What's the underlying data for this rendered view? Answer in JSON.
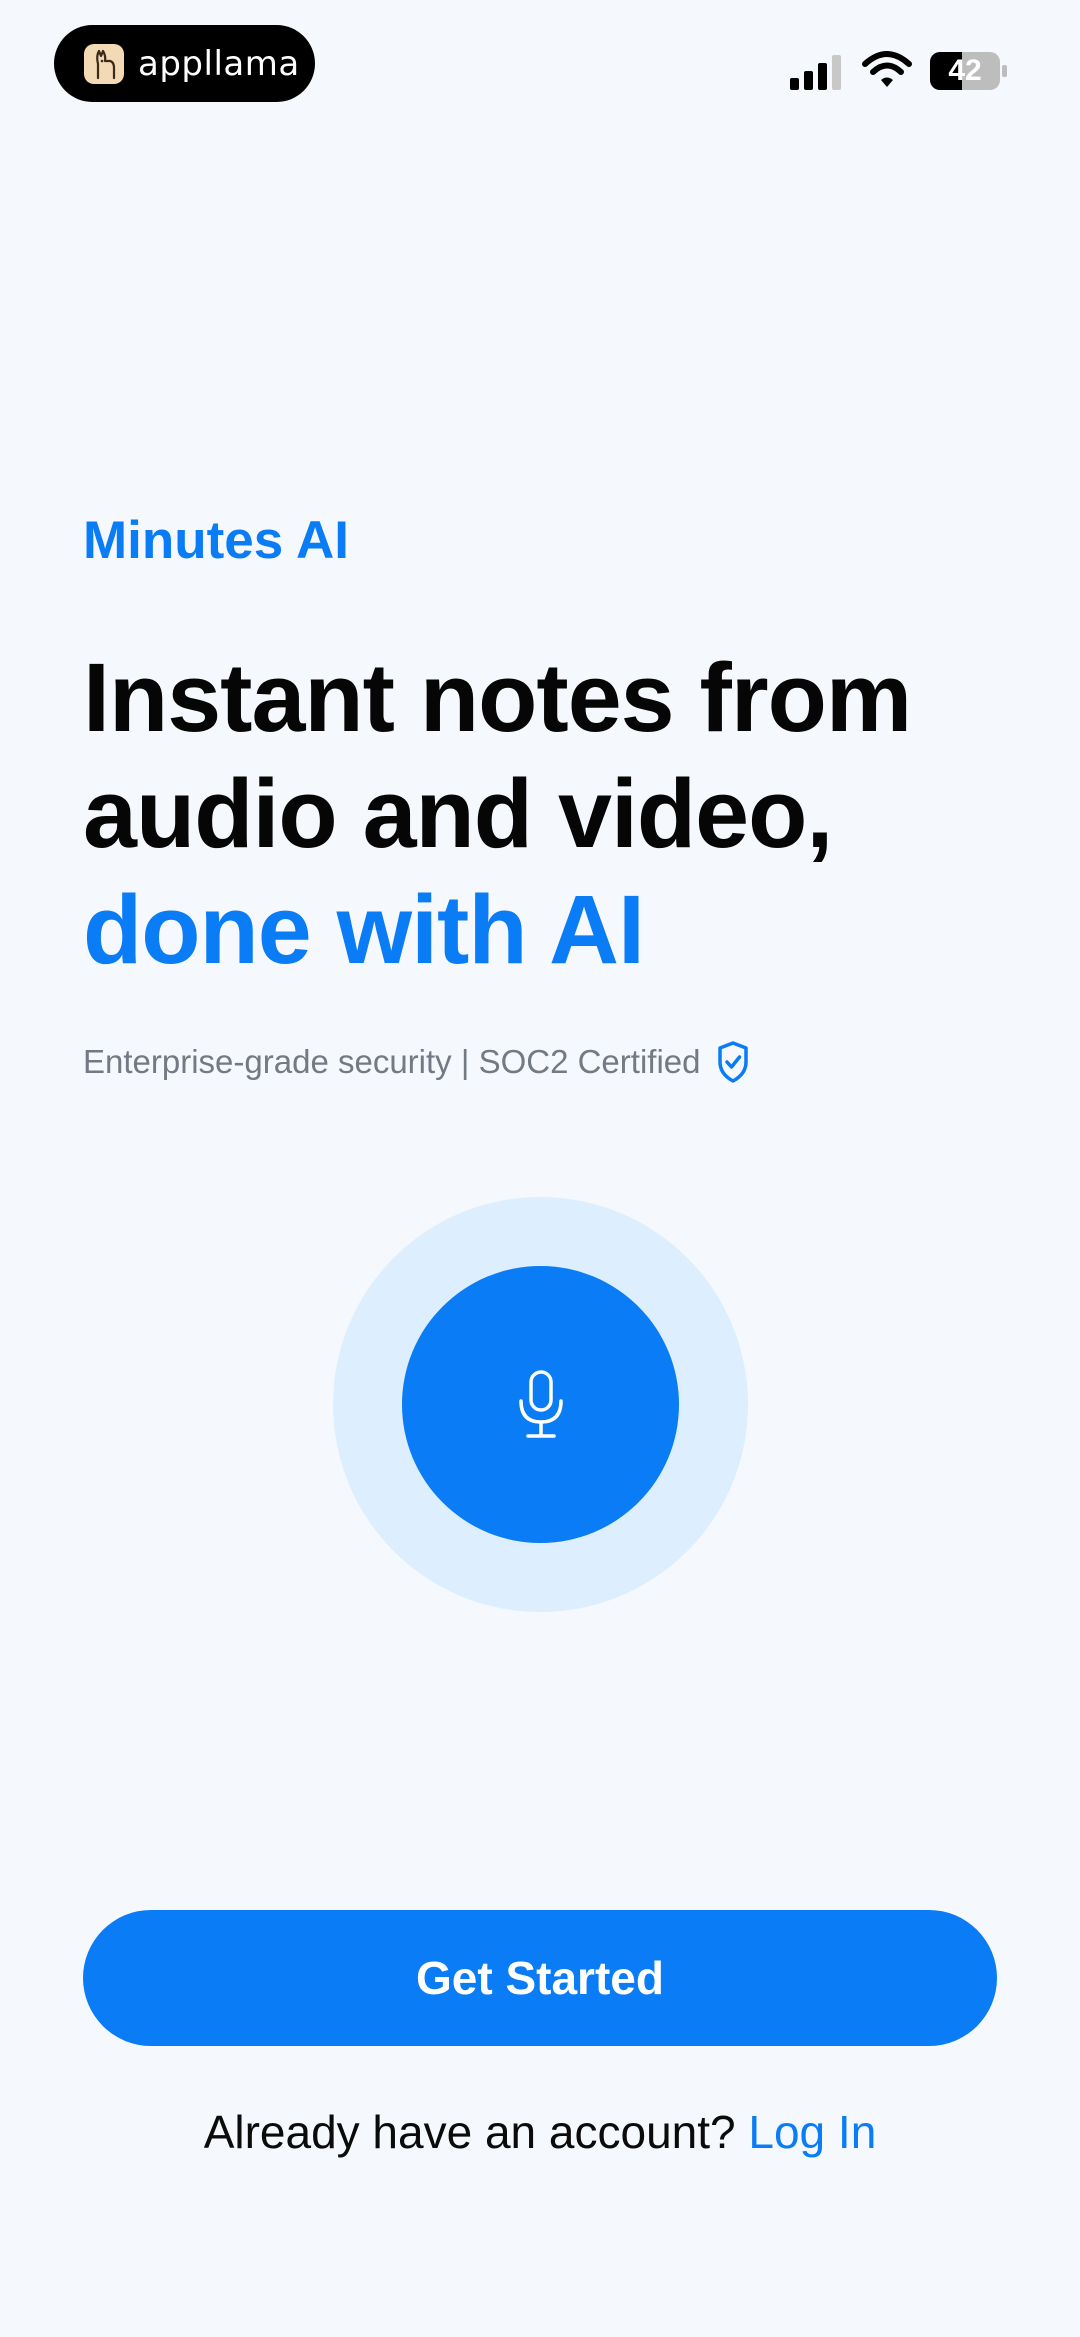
{
  "status_bar": {
    "badge_label": "appllama",
    "battery_level": "42"
  },
  "hero": {
    "eyebrow": "Minutes AI",
    "headline_line1": "Instant notes from",
    "headline_line2": "audio and video,",
    "headline_accent": "done with AI",
    "security_text": "Enterprise-grade security | SOC2 Certified"
  },
  "actions": {
    "get_started_label": "Get Started",
    "login_prompt": "Already have an account?",
    "login_label": "Log In"
  },
  "colors": {
    "accent": "#0A7CF5",
    "background": "#F5F8FC",
    "halo": "#DDEEFE"
  },
  "icons": [
    "llama-icon",
    "cellular-signal-icon",
    "wifi-icon",
    "battery-icon",
    "shield-check-icon",
    "microphone-icon"
  ]
}
